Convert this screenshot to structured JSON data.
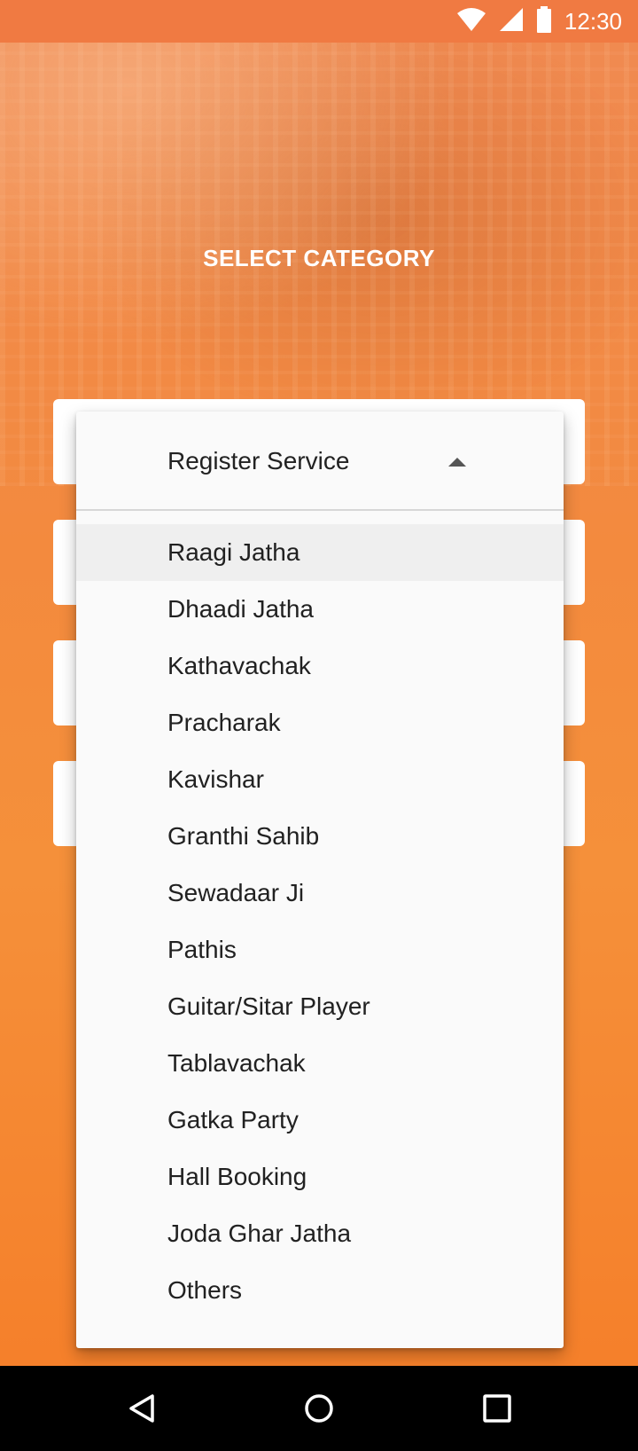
{
  "status_bar": {
    "time": "12:30",
    "icons": [
      "wifi-icon",
      "cellular-signal-icon",
      "battery-icon"
    ]
  },
  "page": {
    "title": "SELECT CATEGORY"
  },
  "dropdown": {
    "selected": "Register Service",
    "options": [
      "Raagi Jatha",
      "Dhaadi Jatha",
      "Kathavachak",
      "Pracharak",
      "Kavishar",
      "Granthi Sahib",
      "Sewadaar Ji",
      "Pathis",
      "Guitar/Sitar Player",
      "Tablavachak",
      "Gatka Party",
      "Hall Booking",
      "Joda Ghar Jatha",
      "Others"
    ]
  },
  "nav_bar": {
    "icons": [
      "back-icon",
      "home-icon",
      "recents-icon"
    ]
  },
  "colors": {
    "accent": "#f5903a",
    "status_bar": "#f07a42",
    "highlight": "#efefef"
  }
}
